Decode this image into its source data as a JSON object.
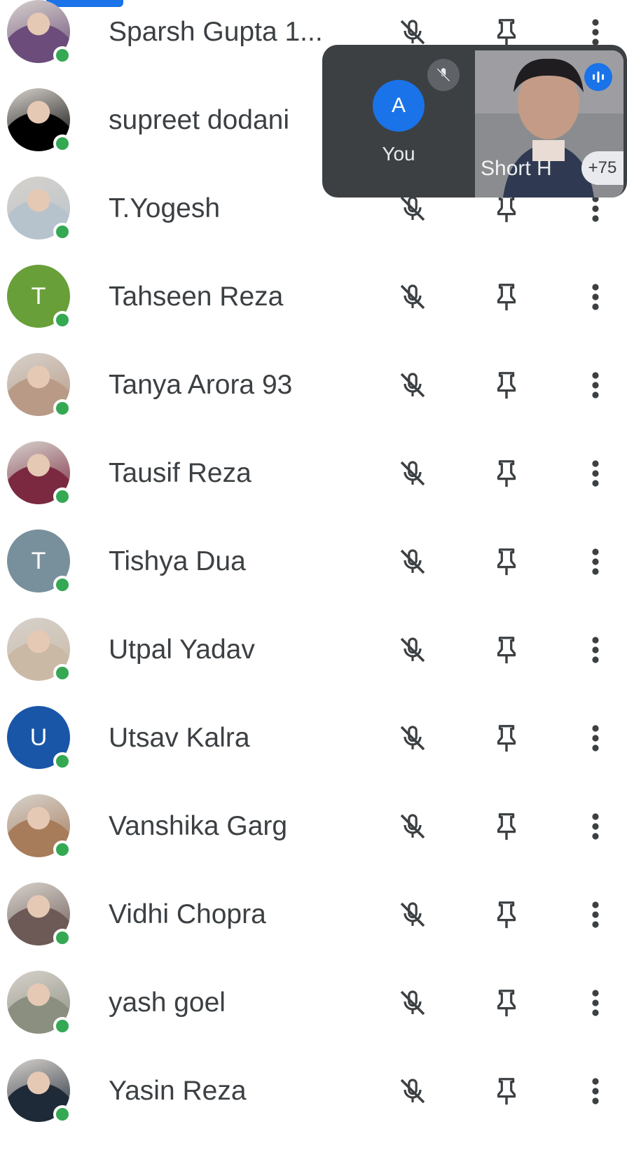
{
  "participants": [
    {
      "name": "Sparsh Gupta 1...",
      "initial": "",
      "avatar_color": "#6b4c7a",
      "photo": true
    },
    {
      "name": "supreet dodani",
      "initial": "",
      "avatar_color": "#000000",
      "photo": true
    },
    {
      "name": "T.Yogesh",
      "initial": "",
      "avatar_color": "#b7c3cc",
      "photo": true
    },
    {
      "name": "Tahseen Reza",
      "initial": "T",
      "avatar_color": "#689f38",
      "photo": false
    },
    {
      "name": "Tanya Arora 93",
      "initial": "",
      "avatar_color": "#b89a86",
      "photo": true
    },
    {
      "name": "Tausif Reza",
      "initial": "",
      "avatar_color": "#7a2940",
      "photo": true
    },
    {
      "name": "Tishya Dua",
      "initial": "T",
      "avatar_color": "#78909c",
      "photo": false
    },
    {
      "name": "Utpal Yadav",
      "initial": "",
      "avatar_color": "#c9b9a5",
      "photo": true
    },
    {
      "name": "Utsav Kalra",
      "initial": "U",
      "avatar_color": "#1a56a8",
      "photo": false
    },
    {
      "name": "Vanshika Garg",
      "initial": "",
      "avatar_color": "#a67c5b",
      "photo": true
    },
    {
      "name": "Vidhi Chopra",
      "initial": "",
      "avatar_color": "#6d5a56",
      "photo": true
    },
    {
      "name": "yash goel",
      "initial": "",
      "avatar_color": "#8b8f80",
      "photo": true
    },
    {
      "name": "Yasin Reza",
      "initial": "",
      "avatar_color": "#1f2a38",
      "photo": true
    }
  ],
  "icons": {
    "mic": "mic-off-icon",
    "pin": "pin-icon",
    "more": "more-vert-icon"
  },
  "pip": {
    "self_initial": "A",
    "self_label": "You",
    "self_mic": "mic-off-icon",
    "remote_label": "Short H",
    "remote_speaking": "speaking-icon",
    "more_count": "+75"
  },
  "colors": {
    "presence": "#34a853",
    "accent": "#1a73e8",
    "text": "#3c4043",
    "icon": "#3c4043"
  }
}
